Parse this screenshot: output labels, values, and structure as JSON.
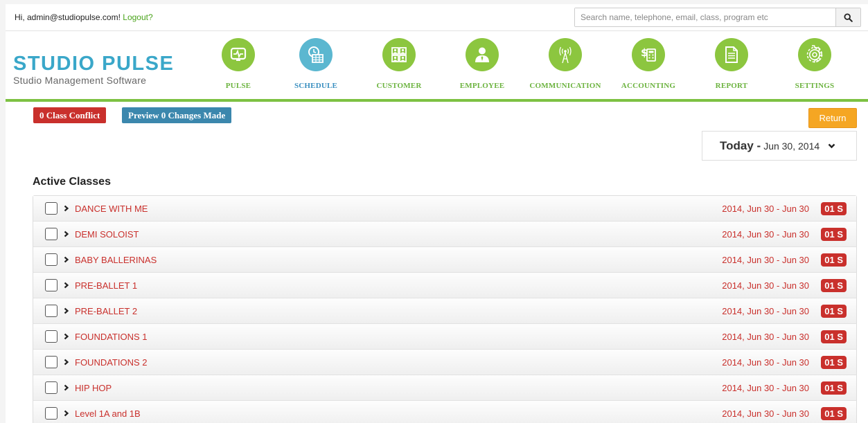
{
  "topbar": {
    "greeting": "Hi, admin@studiopulse.com!",
    "logout": "Logout?",
    "search_placeholder": "Search name, telephone, email, class, program etc"
  },
  "logo": {
    "main": "STUDIO PULSE",
    "sub": "Studio Management Software"
  },
  "nav": [
    {
      "label": "PULSE",
      "icon": "pulse-monitor-icon",
      "active": false
    },
    {
      "label": "SCHEDULE",
      "icon": "calendar-clock-icon",
      "active": true
    },
    {
      "label": "CUSTOMER",
      "icon": "customer-grid-icon",
      "active": false
    },
    {
      "label": "EMPLOYEE",
      "icon": "employee-icon",
      "active": false
    },
    {
      "label": "COMMUNICATION",
      "icon": "antenna-icon",
      "active": false
    },
    {
      "label": "ACCOUNTING",
      "icon": "dollar-calculator-icon",
      "active": false
    },
    {
      "label": "REPORT",
      "icon": "report-document-icon",
      "active": false
    },
    {
      "label": "SETTINGS",
      "icon": "gear-icon",
      "active": false
    }
  ],
  "toolbar": {
    "conflict": "0 Class Conflict",
    "preview": "Preview 0 Changes Made",
    "return": "Return"
  },
  "date": {
    "today": "Today -",
    "value": "Jun 30, 2014"
  },
  "section_title": "Active Classes",
  "classes": [
    {
      "name": "DANCE WITH ME",
      "date": "2014, Jun 30 - Jun 30",
      "badge": "01 S"
    },
    {
      "name": "DEMI SOLOIST",
      "date": "2014, Jun 30 - Jun 30",
      "badge": "01 S"
    },
    {
      "name": "BABY BALLERINAS",
      "date": "2014, Jun 30 - Jun 30",
      "badge": "01 S"
    },
    {
      "name": "PRE-BALLET 1",
      "date": "2014, Jun 30 - Jun 30",
      "badge": "01 S"
    },
    {
      "name": "PRE-BALLET 2",
      "date": "2014, Jun 30 - Jun 30",
      "badge": "01 S"
    },
    {
      "name": "FOUNDATIONS 1",
      "date": "2014, Jun 30 - Jun 30",
      "badge": "01 S"
    },
    {
      "name": "FOUNDATIONS 2",
      "date": "2014, Jun 30 - Jun 30",
      "badge": "01 S"
    },
    {
      "name": "HIP HOP",
      "date": "2014, Jun 30 - Jun 30",
      "badge": "01 S"
    },
    {
      "name": "Level 1A and 1B",
      "date": "2014, Jun 30 - Jun 30",
      "badge": "01 S"
    }
  ],
  "colors": {
    "brand_green": "#8cc63f",
    "active_blue": "#5bb7d0",
    "logo_blue": "#3aa7c9",
    "danger_red": "#c9302c",
    "info_blue": "#3b87ad",
    "warning_orange": "#f5a623"
  }
}
